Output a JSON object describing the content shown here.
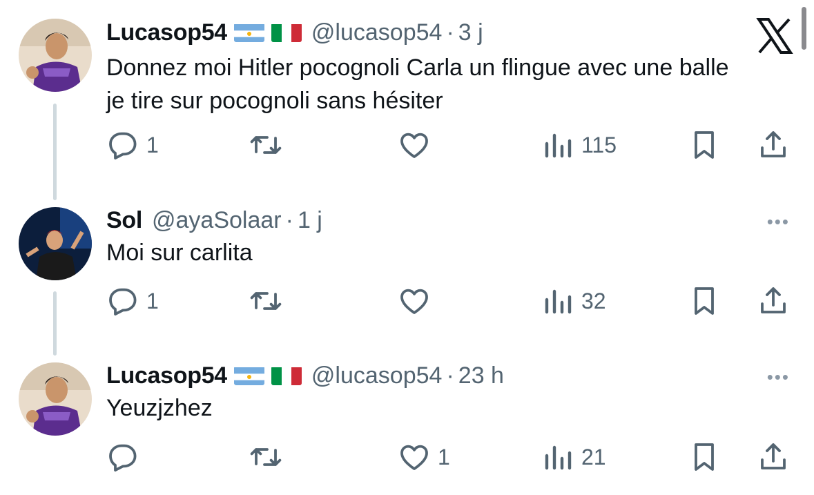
{
  "tweets": [
    {
      "name": "Lucasop54",
      "flags": [
        "argentina-flag",
        "italy-flag"
      ],
      "handle": "@lucasop54",
      "time": "3 j",
      "text_lines": [
        "Donnez moi Hitler pocognoli Carla un flingue avec une balle",
        "je tire sur pocognoli sans hésiter"
      ],
      "replies": "1",
      "retweets": "",
      "likes": "",
      "views": "115"
    },
    {
      "name": "Sol",
      "flags": [],
      "handle": "@ayaSolaar",
      "time": "1 j",
      "text_lines": [
        "Moi sur carlita"
      ],
      "replies": "1",
      "retweets": "",
      "likes": "",
      "views": "32"
    },
    {
      "name": "Lucasop54",
      "flags": [
        "argentina-flag",
        "italy-flag"
      ],
      "handle": "@lucasop54",
      "time": "23 h",
      "text_lines": [
        "Yeuzjzhez"
      ],
      "replies": "",
      "retweets": "",
      "likes": "1",
      "views": "21"
    }
  ],
  "separator": "·",
  "more_label": "•••",
  "colors": {
    "text": "#0f1419",
    "secondary": "#536471",
    "thread_line": "#cfd9de"
  }
}
